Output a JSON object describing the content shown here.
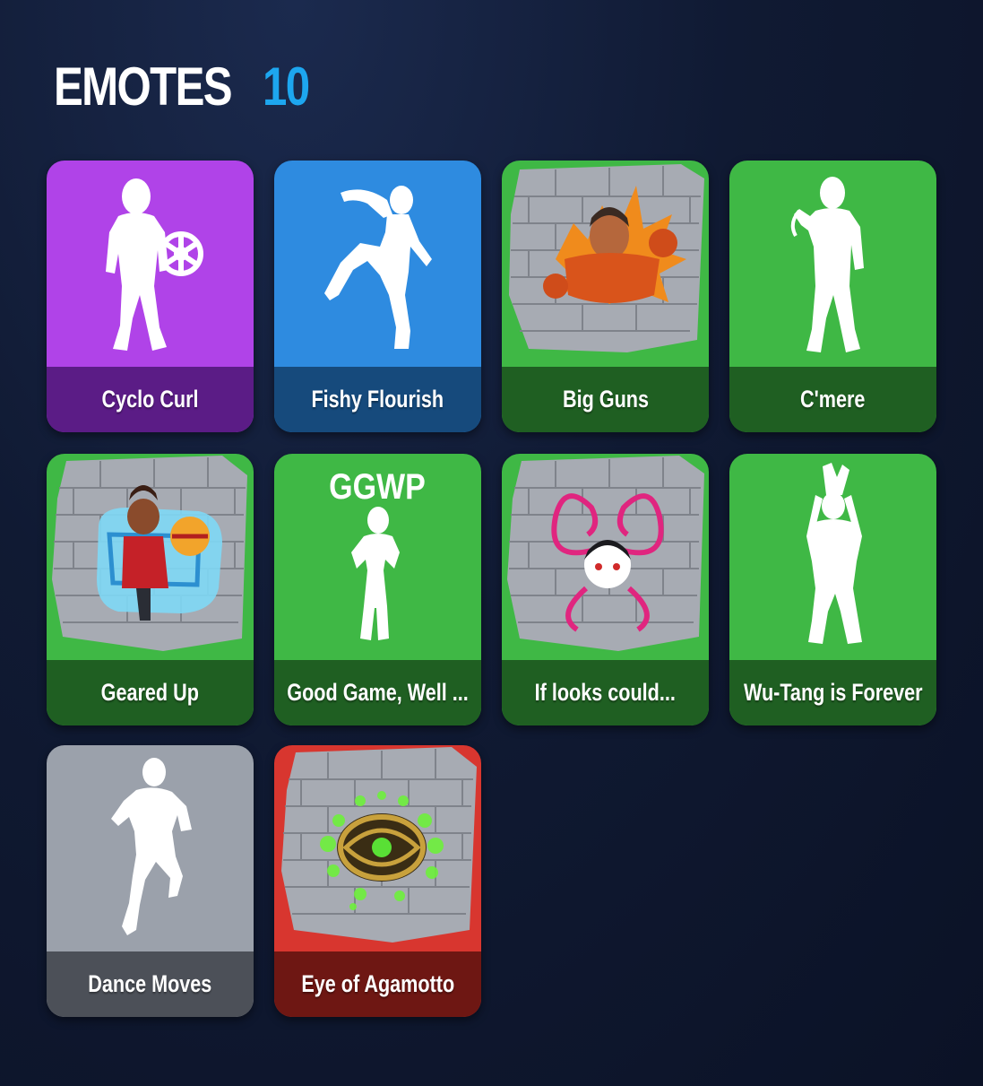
{
  "header": {
    "title": "EMOTES",
    "count": "10",
    "count_color": "#1da6ef"
  },
  "emotes": [
    {
      "label": "Cyclo Curl",
      "rarity_color": "#b043e8",
      "bar_color": "#5b1c86",
      "art": "silhouette-with-wheel"
    },
    {
      "label": "Fishy Flourish",
      "rarity_color": "#2e8be0",
      "bar_color": "#164a7c",
      "art": "silhouette-kick"
    },
    {
      "label": "Big Guns",
      "rarity_color": "#3fb845",
      "bar_color": "#1f5f22",
      "art": "spray-big-guns"
    },
    {
      "label": "C'mere",
      "rarity_color": "#3fb845",
      "bar_color": "#1f5f22",
      "art": "silhouette-standing"
    },
    {
      "label": "Geared Up",
      "rarity_color": "#3fb845",
      "bar_color": "#1f5f22",
      "art": "spray-geared-up"
    },
    {
      "label": "Good Game, Well ...",
      "rarity_color": "#3fb845",
      "bar_color": "#1f5f22",
      "art": "silhouette-ggwp",
      "art_text": "GGWP"
    },
    {
      "label": "If looks could...",
      "rarity_color": "#3fb845",
      "bar_color": "#1f5f22",
      "art": "spray-if-looks-could"
    },
    {
      "label": "Wu-Tang is Forever",
      "rarity_color": "#3fb845",
      "bar_color": "#1f5f22",
      "art": "silhouette-hands-up"
    },
    {
      "label": "Dance Moves",
      "rarity_color": "#9ba1ab",
      "bar_color": "#4c5058",
      "art": "silhouette-dance"
    },
    {
      "label": "Eye of Agamotto",
      "rarity_color": "#d8362f",
      "bar_color": "#6e1713",
      "art": "spray-eye-of-agamotto"
    }
  ]
}
